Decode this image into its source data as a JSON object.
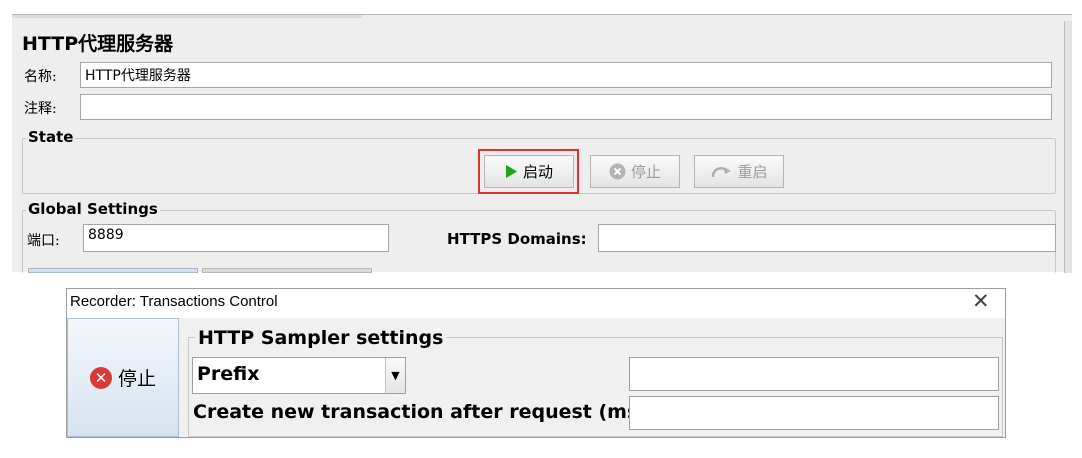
{
  "proxy_panel": {
    "title": "HTTP代理服务器",
    "name_label": "名称:",
    "name_value": "HTTP代理服务器",
    "comment_label": "注释:",
    "comment_value": "",
    "state_group": "State",
    "start_button": "启动",
    "stop_button": "停止",
    "restart_button": "重启",
    "global_group": "Global Settings",
    "port_label": "端口:",
    "port_value": "8889",
    "https_label": "HTTPS Domains:",
    "https_value": ""
  },
  "recorder_dialog": {
    "title": "Recorder: Transactions Control",
    "close_icon": "close-icon",
    "stop_button": "停止",
    "sampler_group": "HTTP Sampler settings",
    "prefix_option": "Prefix",
    "prefix_value": "",
    "transaction_label": "Create new transaction after request (ms):",
    "transaction_value": ""
  },
  "colors": {
    "highlight": "#e03131",
    "play_green": "#1aa51a",
    "stop_red": "#d93a36"
  }
}
